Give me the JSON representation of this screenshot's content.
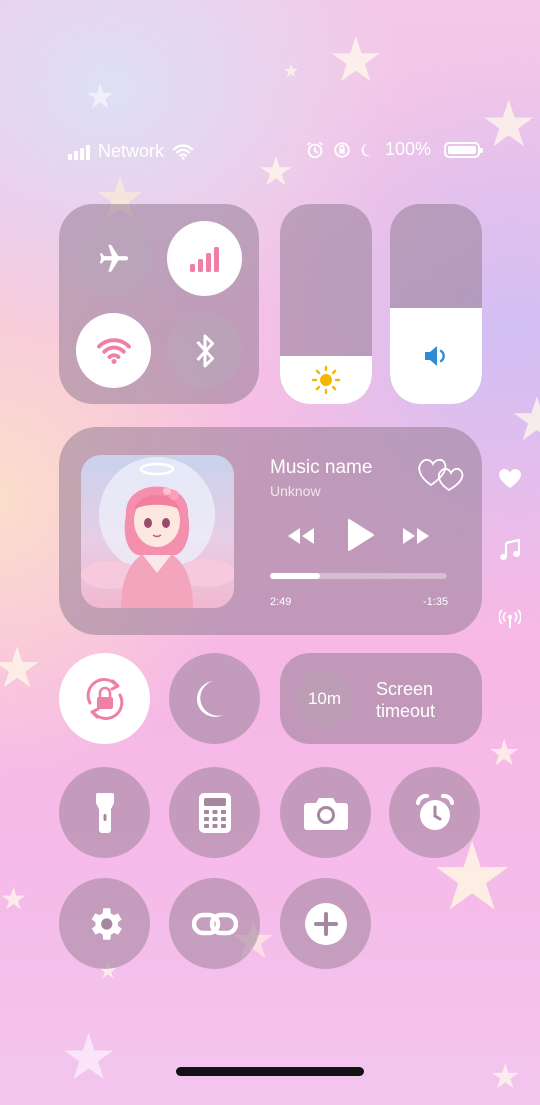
{
  "status_bar": {
    "network_label": "Network",
    "battery_label": "100%"
  },
  "icons": {
    "airplane": "airplane-icon",
    "cellular": "cellular-signal-icon",
    "wifi": "wifi-icon",
    "bluetooth": "bluetooth-icon",
    "brightness": "sun-icon",
    "volume": "speaker-icon",
    "heart": "heart-icon",
    "music": "music-note-icon",
    "broadcast": "broadcast-icon"
  },
  "music": {
    "title": "Music name",
    "artist": "Unknow",
    "elapsed": "2:49",
    "remaining": "-1:35",
    "progress_fraction": 0.28
  },
  "sliders": {
    "brightness_level": 0.24,
    "volume_level": 0.48
  },
  "screen_timeout": {
    "value": "10m",
    "label_line1": "Screen",
    "label_line2": "timeout"
  },
  "colors": {
    "accent_pink": "#ef7fa6",
    "volume_blue": "#2e8bd6",
    "sun_yellow": "#f5b800"
  }
}
